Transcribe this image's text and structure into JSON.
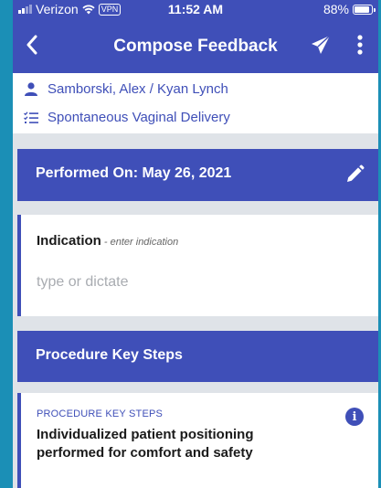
{
  "status_bar": {
    "carrier": "Verizon",
    "vpn": "VPN",
    "time": "11:52 AM",
    "battery": "88%",
    "battery_level": 0.88
  },
  "nav": {
    "title": "Compose Feedback",
    "back_icon": "chevron-left-icon",
    "send_icon": "paper-plane-icon",
    "more_icon": "more-vertical-icon"
  },
  "info": {
    "participants": "Samborski, Alex / Kyan Lynch",
    "procedure": "Spontaneous Vaginal Delivery"
  },
  "performed": {
    "label": "Performed On: May 26, 2021",
    "edit_icon": "pencil-icon"
  },
  "indication": {
    "title": "Indication",
    "hint": " - enter indication",
    "placeholder": "type or dictate",
    "value": ""
  },
  "procedure_key_steps": {
    "header": "Procedure Key Steps",
    "step": {
      "category": "PROCEDURE KEY STEPS",
      "text": "Individualized patient positioning performed for comfort and safety",
      "info_icon": "info-icon"
    }
  },
  "colors": {
    "primary": "#3f4fb8",
    "background": "#dfe3e8",
    "outer": "#1b8fb6"
  }
}
